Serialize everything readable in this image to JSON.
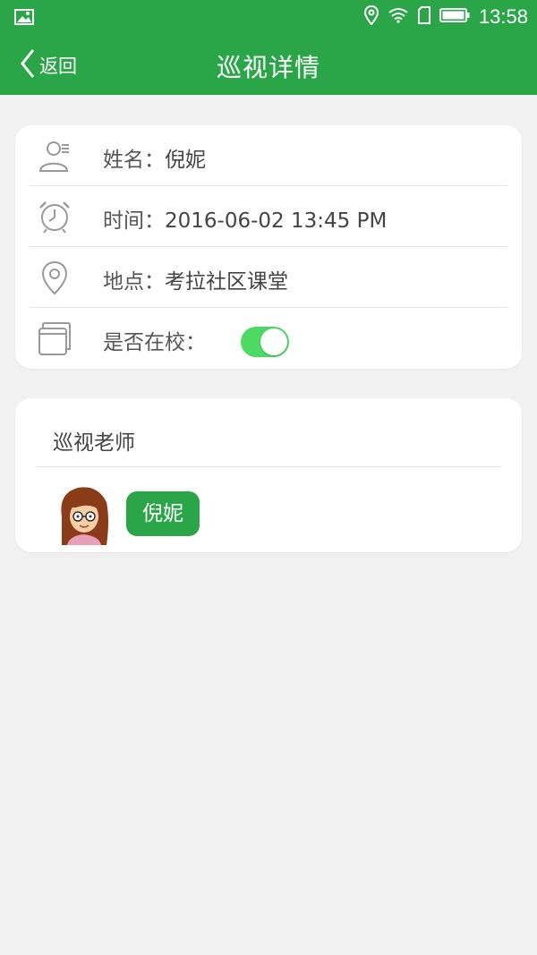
{
  "status_bar": {
    "time": "13:58"
  },
  "header": {
    "back_label": "返回",
    "title": "巡视详情"
  },
  "details": {
    "name_label": "姓名：",
    "name_value": "倪妮",
    "time_label": "时间：",
    "time_value": "2016-06-02 13:45 PM",
    "place_label": "地点：",
    "place_value": "考拉社区课堂",
    "at_school_label": "是否在校：",
    "at_school_on": true
  },
  "teachers": {
    "title": "巡视老师",
    "items": [
      {
        "name": "倪妮"
      }
    ]
  },
  "colors": {
    "accent": "#2aa648",
    "toggle": "#4cd964"
  }
}
